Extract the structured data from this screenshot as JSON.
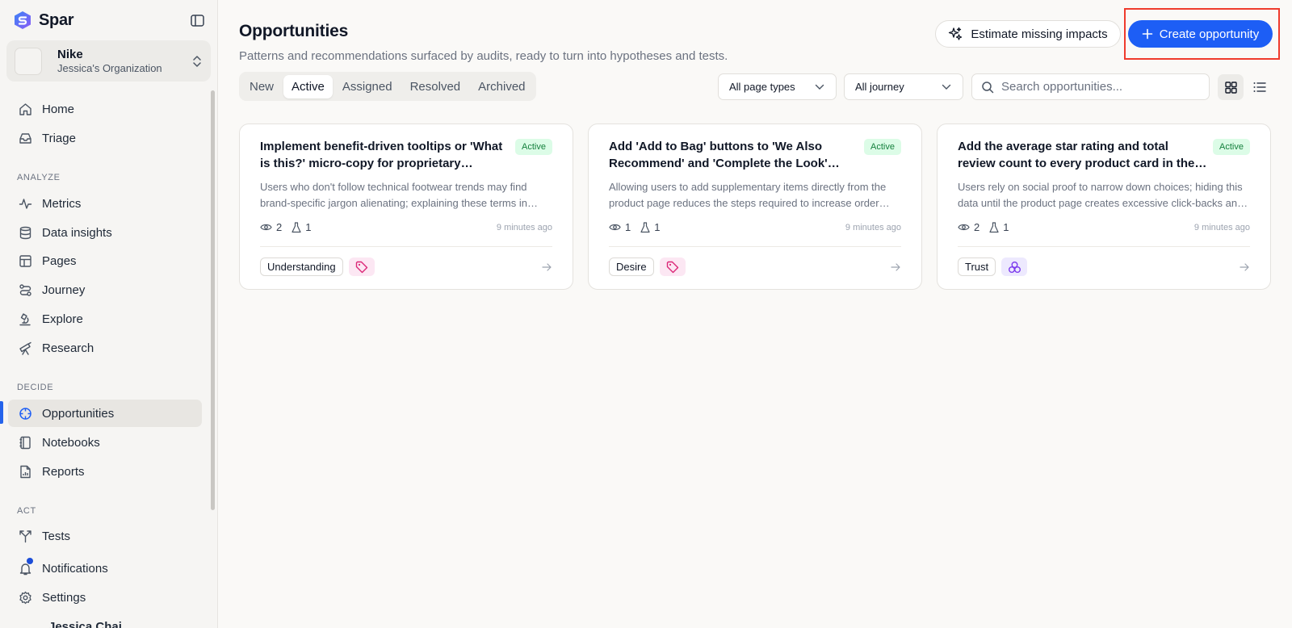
{
  "app": {
    "name": "Spar"
  },
  "org": {
    "name": "Nike",
    "subtitle": "Jessica's Organization"
  },
  "sidebar": {
    "top_items": [
      {
        "label": "Home",
        "icon": "home-icon"
      },
      {
        "label": "Triage",
        "icon": "inbox-icon"
      }
    ],
    "sections": [
      {
        "label": "ANALYZE",
        "items": [
          {
            "label": "Metrics",
            "icon": "activity-icon"
          },
          {
            "label": "Data insights",
            "icon": "database-icon"
          },
          {
            "label": "Pages",
            "icon": "layout-icon"
          },
          {
            "label": "Journey",
            "icon": "route-icon"
          },
          {
            "label": "Explore",
            "icon": "microscope-icon"
          },
          {
            "label": "Research",
            "icon": "telescope-icon"
          }
        ]
      },
      {
        "label": "DECIDE",
        "items": [
          {
            "label": "Opportunities",
            "icon": "crosshair-icon",
            "active": true
          },
          {
            "label": "Notebooks",
            "icon": "notebook-icon"
          },
          {
            "label": "Reports",
            "icon": "report-icon"
          }
        ]
      },
      {
        "label": "ACT",
        "items": [
          {
            "label": "Tests",
            "icon": "split-icon"
          },
          {
            "label": "Notifications",
            "icon": "bell-icon",
            "has_dot": true
          },
          {
            "label": "Settings",
            "icon": "gear-icon"
          }
        ]
      }
    ],
    "bottom_user": "Jessica Chai..."
  },
  "header": {
    "title": "Opportunities",
    "subtitle": "Patterns and recommendations surfaced by audits, ready to turn into hypotheses and tests.",
    "estimate_label": "Estimate missing impacts",
    "create_label": "Create opportunity"
  },
  "tabs": [
    {
      "label": "New"
    },
    {
      "label": "Active",
      "active": true
    },
    {
      "label": "Assigned"
    },
    {
      "label": "Resolved"
    },
    {
      "label": "Archived"
    }
  ],
  "filters": {
    "page_type": "All page types",
    "journey": "All journey",
    "search_placeholder": "Search opportunities...",
    "view_mode": "grid"
  },
  "cards": [
    {
      "title": "Implement benefit-driven tooltips or 'What is this?' micro-copy for proprietary technologies",
      "badge": "Active",
      "description": "Users who don't follow technical footwear trends may find brand-specific jargon alienating; explaining these terms in plain language helps build trust.",
      "views": "2",
      "tests": "1",
      "time": "9 minutes ago",
      "tag": "Understanding",
      "tag_icon": "tag-icon",
      "tag_icon_color": "#db2777",
      "tag_icon_bg": "#fce7f3"
    },
    {
      "title": "Add 'Add to Bag' buttons to 'We Also Recommend' and 'Complete the Look' sections",
      "badge": "Active",
      "description": "Allowing users to add supplementary items directly from the product page reduces the steps required to increase order value.",
      "views": "1",
      "tests": "1",
      "time": "9 minutes ago",
      "tag": "Desire",
      "tag_icon": "tag-icon",
      "tag_icon_color": "#db2777",
      "tag_icon_bg": "#fce7f3"
    },
    {
      "title": "Add the average star rating and total review count to every product card in the collection grid",
      "badge": "Active",
      "description": "Users rely on social proof to narrow down choices; hiding this data until the product page creates excessive click-backs and pogo-sticking.",
      "views": "2",
      "tests": "1",
      "time": "9 minutes ago",
      "tag": "Trust",
      "tag_icon": "circles-icon",
      "tag_icon_color": "#7c3aed",
      "tag_icon_bg": "#ede9fe"
    }
  ],
  "colors": {
    "accent": "#1d5ef5",
    "highlight": "#ef3b2d",
    "active_badge_bg": "#dcfce7",
    "active_badge_text": "#15803d"
  }
}
